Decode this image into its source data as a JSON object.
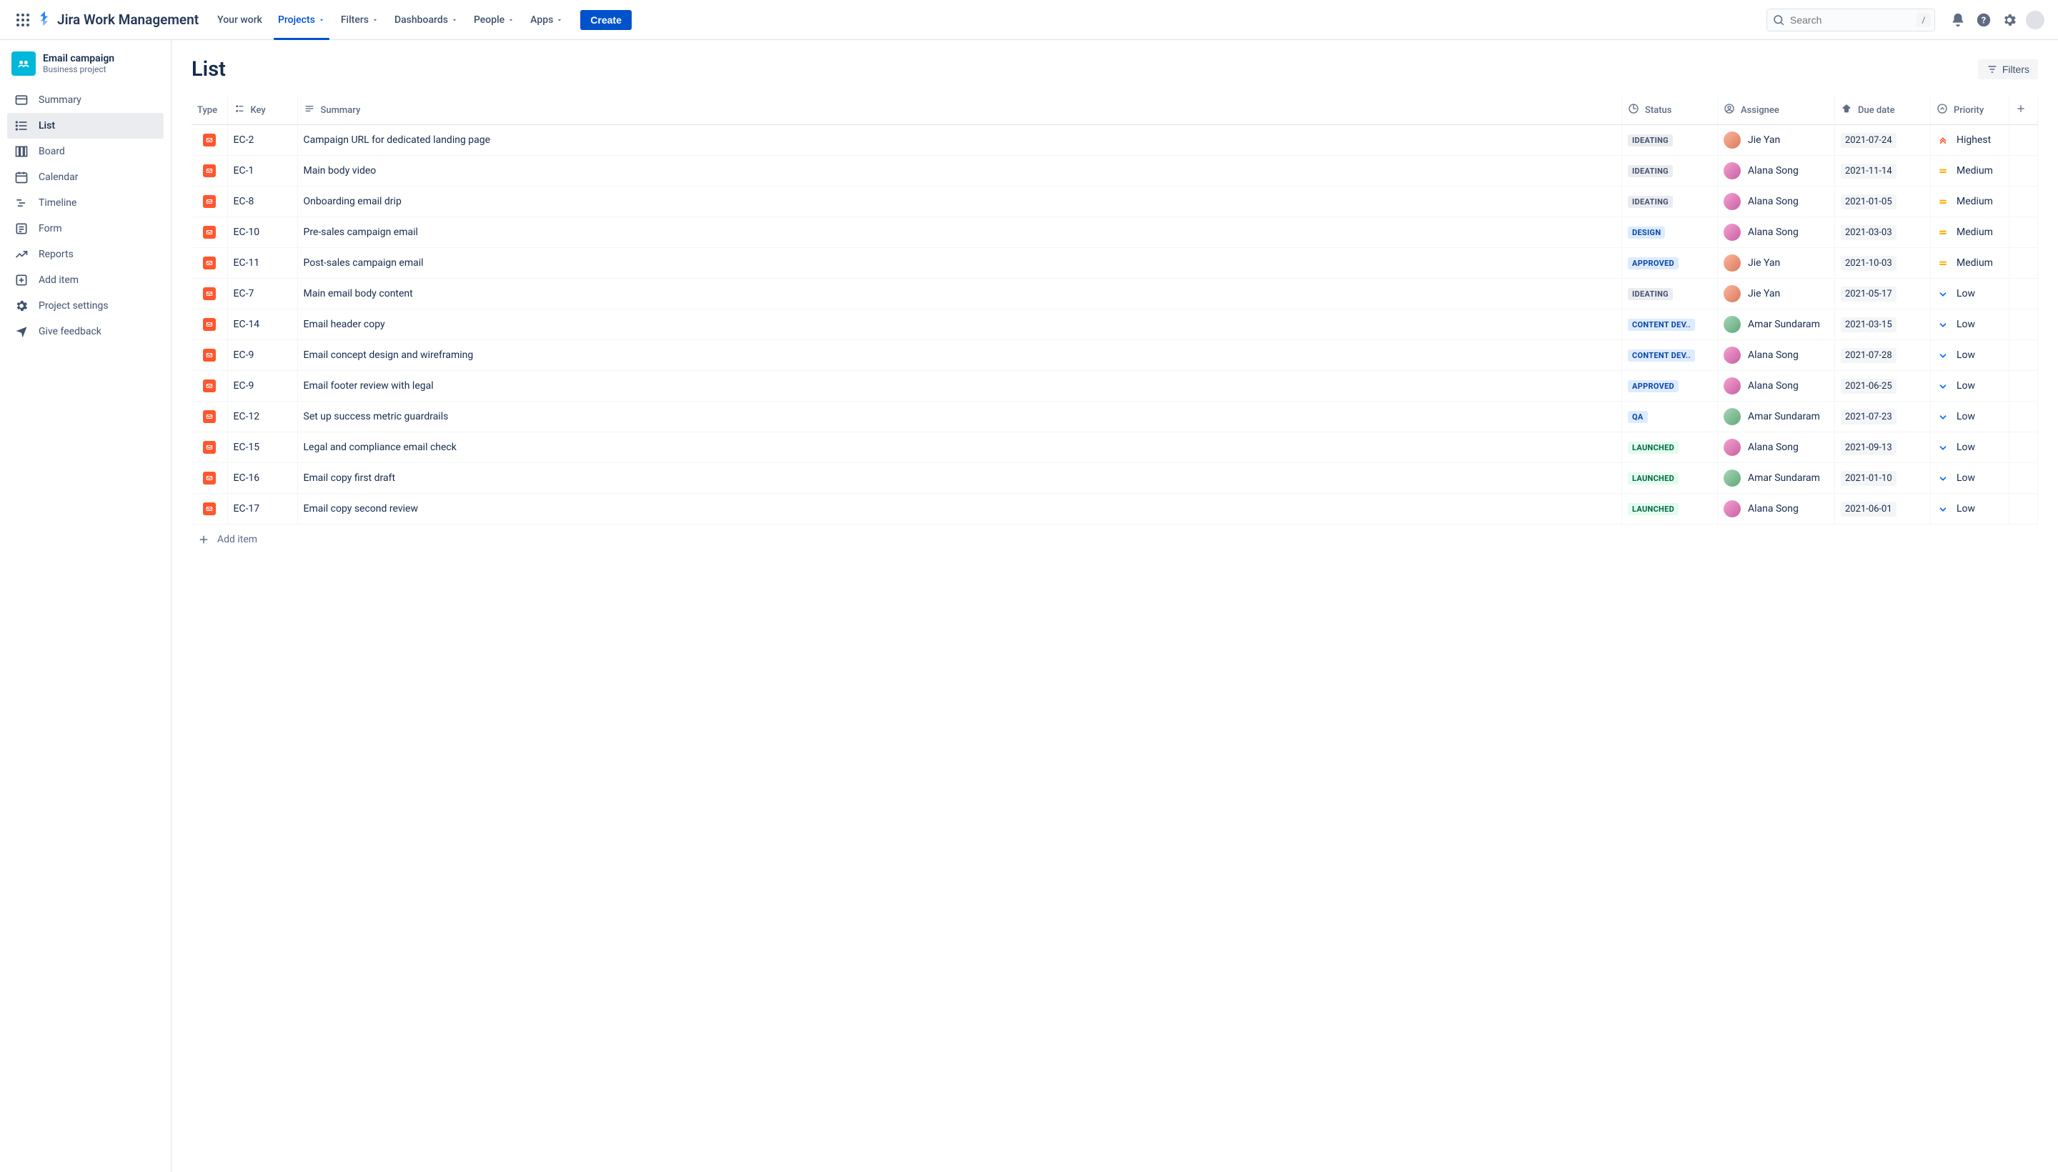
{
  "top": {
    "product": "Jira Work Management",
    "nav": [
      "Your work",
      "Projects",
      "Filters",
      "Dashboards",
      "People",
      "Apps"
    ],
    "active_index": 1,
    "create": "Create",
    "search_placeholder": "Search",
    "search_shortcut": "/"
  },
  "project": {
    "name": "Email campaign",
    "type": "Business project"
  },
  "sidebar": {
    "items": [
      "Summary",
      "List",
      "Board",
      "Calendar",
      "Timeline",
      "Form",
      "Reports",
      "Add item",
      "Project settings",
      "Give feedback"
    ],
    "selected_index": 1
  },
  "page": {
    "title": "List",
    "filters_label": "Filters",
    "add_item": "Add item"
  },
  "columns": [
    "Type",
    "Key",
    "Summary",
    "Status",
    "Assignee",
    "Due date",
    "Priority"
  ],
  "assignees": {
    "jie": {
      "name": "Jie Yan",
      "avatar": "a"
    },
    "alana": {
      "name": "Alana Song",
      "avatar": "b"
    },
    "amar": {
      "name": "Amar Sundaram",
      "avatar": "c"
    }
  },
  "statuses": {
    "IDEATING": {
      "label": "IDEATING",
      "tone": "grey"
    },
    "DESIGN": {
      "label": "DESIGN",
      "tone": "blue"
    },
    "APPROVED": {
      "label": "APPROVED",
      "tone": "blue"
    },
    "CONTENT_DEV": {
      "label": "CONTENT DEV..",
      "tone": "blue"
    },
    "QA": {
      "label": "QA",
      "tone": "blue"
    },
    "LAUNCHED": {
      "label": "LAUNCHED",
      "tone": "green"
    }
  },
  "priorities": {
    "highest": {
      "label": "Highest",
      "color": "#FF5630"
    },
    "medium": {
      "label": "Medium",
      "color": "#FFAB00"
    },
    "low": {
      "label": "Low",
      "color": "#0065FF"
    }
  },
  "rows": [
    {
      "key": "EC-2",
      "summary": "Campaign URL for dedicated landing page",
      "status": "IDEATING",
      "assignee": "jie",
      "due": "2021-07-24",
      "priority": "highest"
    },
    {
      "key": "EC-1",
      "summary": "Main body video",
      "status": "IDEATING",
      "assignee": "alana",
      "due": "2021-11-14",
      "priority": "medium"
    },
    {
      "key": "EC-8",
      "summary": "Onboarding email drip",
      "status": "IDEATING",
      "assignee": "alana",
      "due": "2021-01-05",
      "priority": "medium"
    },
    {
      "key": "EC-10",
      "summary": "Pre-sales campaign email",
      "status": "DESIGN",
      "assignee": "alana",
      "due": "2021-03-03",
      "priority": "medium"
    },
    {
      "key": "EC-11",
      "summary": "Post-sales campaign email",
      "status": "APPROVED",
      "assignee": "jie",
      "due": "2021-10-03",
      "priority": "medium"
    },
    {
      "key": "EC-7",
      "summary": "Main email body content",
      "status": "IDEATING",
      "assignee": "jie",
      "due": "2021-05-17",
      "priority": "low"
    },
    {
      "key": "EC-14",
      "summary": "Email header copy",
      "status": "CONTENT_DEV",
      "assignee": "amar",
      "due": "2021-03-15",
      "priority": "low"
    },
    {
      "key": "EC-9",
      "summary": "Email concept design and wireframing",
      "status": "CONTENT_DEV",
      "assignee": "alana",
      "due": "2021-07-28",
      "priority": "low"
    },
    {
      "key": "EC-9",
      "summary": "Email footer review with legal",
      "status": "APPROVED",
      "assignee": "alana",
      "due": "2021-06-25",
      "priority": "low"
    },
    {
      "key": "EC-12",
      "summary": "Set up success metric guardrails",
      "status": "QA",
      "assignee": "amar",
      "due": "2021-07-23",
      "priority": "low"
    },
    {
      "key": "EC-15",
      "summary": "Legal and compliance email check",
      "status": "LAUNCHED",
      "assignee": "alana",
      "due": "2021-09-13",
      "priority": "low"
    },
    {
      "key": "EC-16",
      "summary": "Email copy first draft",
      "status": "LAUNCHED",
      "assignee": "amar",
      "due": "2021-01-10",
      "priority": "low"
    },
    {
      "key": "EC-17",
      "summary": "Email copy second review",
      "status": "LAUNCHED",
      "assignee": "alana",
      "due": "2021-06-01",
      "priority": "low"
    }
  ]
}
